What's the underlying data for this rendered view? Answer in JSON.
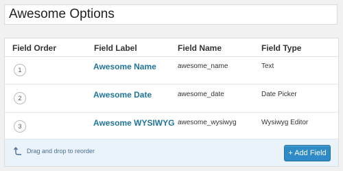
{
  "title_field": {
    "value": "Awesome Options"
  },
  "table": {
    "headers": {
      "order": "Field Order",
      "label": "Field Label",
      "name": "Field Name",
      "type": "Field Type"
    },
    "rows": [
      {
        "order": "1",
        "label": "Awesome Name",
        "name": "awesome_name",
        "type": "Text"
      },
      {
        "order": "2",
        "label": "Awesome Date",
        "name": "awesome_date",
        "type": "Date Picker"
      },
      {
        "order": "3",
        "label": "Awesome WYSIWYG",
        "name": "awesome_wysiwyg",
        "type": "Wysiwyg Editor"
      }
    ]
  },
  "footer": {
    "drag_hint": "Drag and drop to reorder",
    "drag_icon": "curved-arrow-up-icon",
    "add_button": "+ Add Field"
  },
  "colors": {
    "link": "#21759b",
    "button": "#2e8bc7",
    "footer_bg": "#eaf2fa"
  }
}
